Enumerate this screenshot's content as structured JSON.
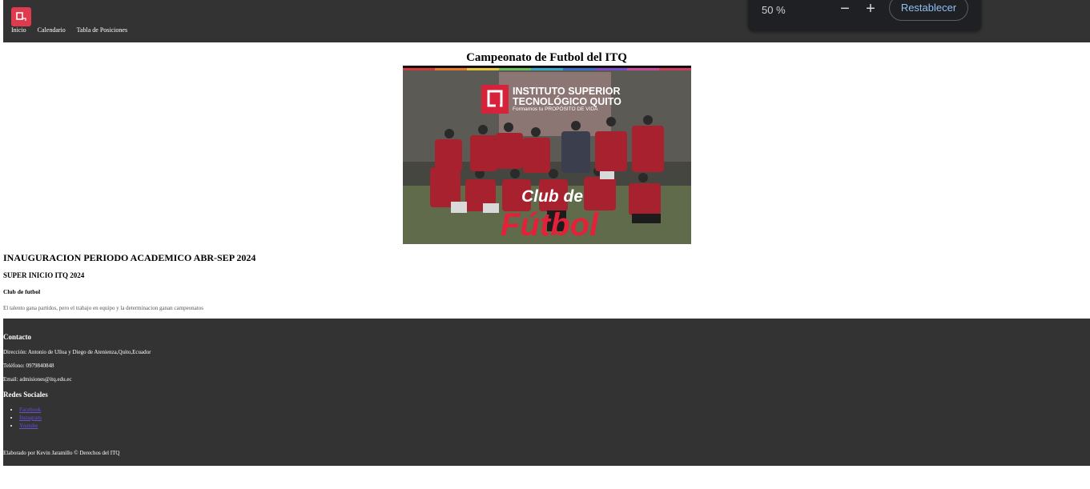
{
  "nav": {
    "logo_icon": "itq-logo-icon",
    "links": [
      "Inicio",
      "Calendario",
      "Tabla de Posiciones"
    ]
  },
  "zoom": {
    "level": "50 %",
    "minus": "−",
    "plus": "+",
    "reset_label": "Restablecer"
  },
  "main": {
    "title": "Campeonato de Futbol del ITQ",
    "hero": {
      "brand_line1": "INSTITUTO SUPERIOR",
      "brand_line2": "TECNOLÓGICO QUITO",
      "brand_tagline": "Formamos tu PROPÓSITO DE VIDA",
      "club_line1": "Club de",
      "club_line2": "Fútbol"
    },
    "news_title": "INAUGURACION PERIODO ACADEMICO ABR-SEP 2024",
    "news_subtitle": "SUPER INICIO ITQ 2024",
    "club_heading": "Club de futbol",
    "club_text": "El talento gana partidos, pero el trabajo en equipo y la determinacion ganan campeonatos"
  },
  "footer": {
    "contact_heading": "Contacto",
    "address": "Dirección: Antonio de Ulloa y Diego de Atenienza,Quito,Ecuador",
    "phone": "Teléfono: 0979840848",
    "email": "Email: admisiones@itq.edu.ec",
    "social_heading": "Redes Sociales",
    "social_links": [
      "Facebook",
      "Instagram",
      "Youtube"
    ],
    "credit": "Elaborado por Kevin Jaramillo © Derechos del ITQ"
  },
  "colors": {
    "nav_bg": "#333333",
    "brand_red": "#e03a4e",
    "zoom_bg": "#1f2023",
    "zoom_accent": "#8ec0f0"
  }
}
